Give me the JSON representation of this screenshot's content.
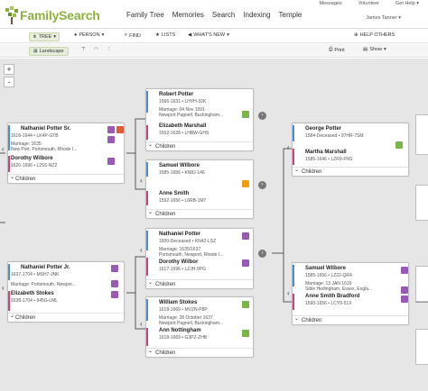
{
  "app": {
    "logo_text": "FamilySearch"
  },
  "nav": [
    "Family Tree",
    "Memories",
    "Search",
    "Indexing",
    "Temple"
  ],
  "util": {
    "messages": "Messages",
    "volunteer": "Volunteer",
    "help": "Get Help",
    "user": "James Tanner"
  },
  "toolbar": {
    "tree": "TREE",
    "person": "PERSON",
    "find": "FIND",
    "lists": "LISTS",
    "whats_new": "WHAT'S NEW",
    "help_others": "HELP OTHERS"
  },
  "subbar": {
    "landscape": "Landscape",
    "print": "Print",
    "show": "Show"
  },
  "zoom": {
    "plus": "+",
    "minus": "-"
  },
  "colors": {
    "brand": "#8cb23f",
    "male": "#4a8cd6",
    "female": "#d6407a"
  },
  "cards": [
    {
      "id": "gen1a",
      "husband": {
        "name": "Nathaniel Potter Sr.",
        "info1": "1616-1644 • LK4P-GTB"
      },
      "marriage": "Marriage: 1635",
      "marriage_place": "New Port, Portsmouth, Rhode I...",
      "wife": {
        "name": "Dorothy Wilbore",
        "info1": "1620-1696 • L2S5-NZ2"
      },
      "children": "Children"
    },
    {
      "id": "gen1b",
      "husband": {
        "name": "Nathaniel Potter Jr.",
        "info1": "1637-1704 • MSH7-JNK"
      },
      "marriage": "Marriage: Portsmouth, Newpor...",
      "marriage_place": "",
      "wife": {
        "name": "Elizabeth Stokes",
        "info1": "1638-1704 • 945G-LML"
      },
      "children": "Children"
    },
    {
      "id": "gen2a",
      "husband": {
        "name": "Robert Potter",
        "info1": "1566-1631 • LHYH-32K"
      },
      "marriage": "Marriage: 04 Nov 1591",
      "marriage_place": "Newport Pagnell, Buckingham...",
      "wife": {
        "name": "Elizabeth Marshall",
        "info1": "1562-1628 • LHBW-GHS"
      },
      "children": "Children"
    },
    {
      "id": "gen2b",
      "husband": {
        "name": "Samuel Wilbore",
        "info1": "1585-1656 • KN8J-146"
      },
      "marriage": "",
      "marriage_place": "",
      "wife": {
        "name": "Anne Smith",
        "info1": "1592-1656 • L6RB-1M7"
      },
      "children": "Children"
    },
    {
      "id": "gen2c",
      "husband": {
        "name": "Nathaniel Potter",
        "info1": "1600-Deceased • KN42-LSZ"
      },
      "marriage": "Marriage: 1635/1637",
      "marriage_place": "Portsmouth, Newport, Rhode I...",
      "wife": {
        "name": "Dorothy Wilbor",
        "info1": "1617-1696 • LZJH-9PG"
      },
      "children": "Children"
    },
    {
      "id": "gen2d",
      "husband": {
        "name": "William Stokes",
        "info1": "1618-1669 • MVZN-P8P"
      },
      "marriage": "Marriage: 28 October 1637",
      "marriage_place": "Newport Pagnell, Buckingham...",
      "wife": {
        "name": "Ann Nottingham",
        "info1": "1618-1669 • G3PZ-ZHB"
      },
      "children": "Children"
    },
    {
      "id": "gen3a",
      "husband": {
        "name": "George Potter",
        "info1": "1584-Deceased • 97HR-7SM"
      },
      "marriage": "",
      "marriage_place": "",
      "wife": {
        "name": "Martha Marshall",
        "info1": "1585-1646 • LZR9-FNS"
      },
      "children": "Children"
    },
    {
      "id": "gen3b",
      "husband": {
        "name": "Samuel Wilbore",
        "info1": "1585-1656 • LZ22-QR4"
      },
      "marriage": "Marriage: 13 JAN 1619",
      "marriage_place": "Sible Hedingham, Essex, Engla...",
      "wife": {
        "name": "Anne Smith Bradford",
        "info1": "1590-1656 • LCY9-51X"
      },
      "children": "Children"
    }
  ]
}
